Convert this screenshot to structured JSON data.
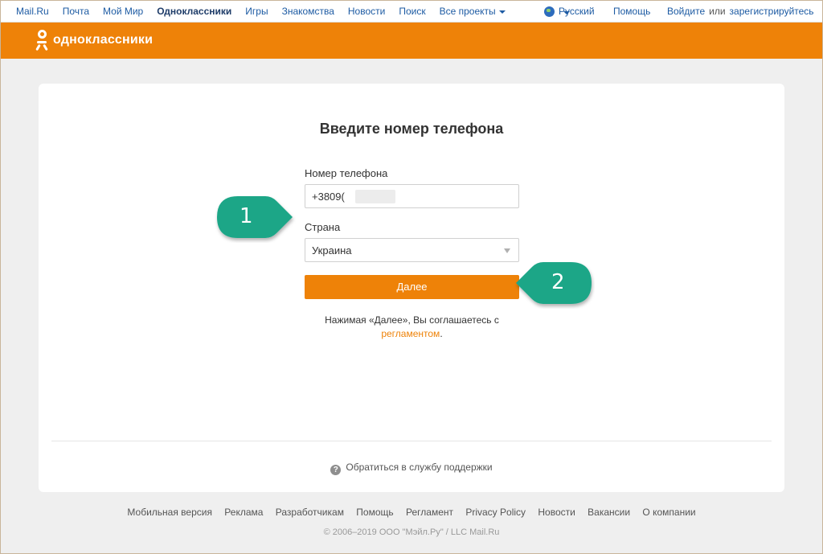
{
  "topbar": {
    "nav": [
      "Mail.Ru",
      "Почта",
      "Мой Мир",
      "Одноклассники",
      "Игры",
      "Знакомства",
      "Новости",
      "Поиск",
      "Все проекты"
    ],
    "language": "Русский",
    "help": "Помощь",
    "login": "Войдите",
    "or": "или",
    "register": "зарегистрируйтесь"
  },
  "header": {
    "logo_text": "одноклассники",
    "color": "#ee8208"
  },
  "form": {
    "title": "Введите номер телефона",
    "phone_label": "Номер телефона",
    "phone_value": "+3809(",
    "country_label": "Страна",
    "country_value": "Украина",
    "submit_label": "Далее",
    "agreement_text": "Нажимая «Далее», Вы соглашаетесь с",
    "agreement_link": "регламентом",
    "agreement_end": "."
  },
  "support": {
    "text": "Обратиться в службу поддержки",
    "icon": "question-icon"
  },
  "callouts": [
    {
      "number": "1"
    },
    {
      "number": "2"
    }
  ],
  "footer": {
    "links": [
      "Мобильная версия",
      "Реклама",
      "Разработчикам",
      "Помощь",
      "Регламент",
      "Privacy Policy",
      "Новости",
      "Вакансии",
      "О компании"
    ],
    "copyright": "© 2006–2019 ООО \"Мэйл.Ру\" / LLC Mail.Ru"
  },
  "colors": {
    "accent": "#ee8208",
    "link": "#1d5ba3",
    "callout": "#1aa687"
  }
}
